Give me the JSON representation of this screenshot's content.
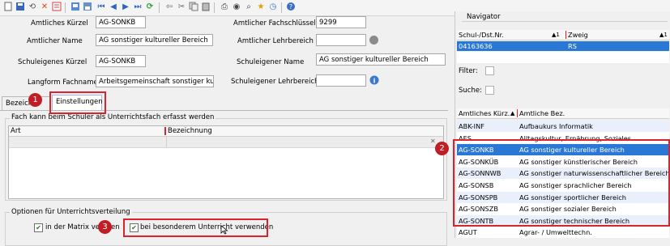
{
  "toolbar": {
    "icons": [
      "new-icon",
      "save-icon",
      "undo-icon",
      "delete-icon",
      "copy-icon",
      "grid-icon",
      "save-as-icon",
      "first-icon",
      "prev-icon",
      "next-icon",
      "last-icon",
      "refresh-icon",
      "back-icon",
      "cut-icon",
      "copy2-icon",
      "paste-icon",
      "print-icon",
      "preview-icon",
      "search-icon",
      "wizard-icon",
      "clock-icon",
      "help-icon"
    ]
  },
  "form": {
    "amtliches_kuerzel_label": "Amtliches  Kürzel",
    "amtliches_kuerzel_value": "AG-SONKB",
    "amtlicher_name_label": "Amtlicher Name",
    "amtlicher_name_value": "AG sonstiger kultureller Bereich",
    "schuleigenes_kuerzel_label": "Schuleigenes Kürzel",
    "schuleigenes_kuerzel_value": "AG-SONKB",
    "langform_label": "Langform Fachname",
    "langform_value": "Arbeitsgemeinschaft sonstiger kultu",
    "amtlicher_fachschluessel_label": "Amtlicher Fachschlüssel",
    "amtlicher_fachschluessel_value": "9299",
    "amtlicher_lehrbereich_label": "Amtlicher Lehrbereich",
    "amtlicher_lehrbereich_value": "",
    "schuleigener_name_label": "Schuleigener Name",
    "schuleigener_name_value": "AG sonstiger kultureller Bereich",
    "schuleigener_lehrbereich_label": "Schuleigener Lehrbereich",
    "schuleigener_lehrbereich_value": ""
  },
  "tabs": [
    {
      "label": "Bezeich"
    },
    {
      "label": "Einstellungen"
    }
  ],
  "section1": {
    "title": "Fach kann beim Schüler als Unterrichtsfach erfasst werden",
    "col_art": "Art",
    "col_bezeichnung": "Bezeichnung"
  },
  "section2": {
    "title": "Optionen für Unterrichtsverteilung",
    "check1_label": "in der Matrix ve",
    "check1_label_tail": "en",
    "check2_label": "bei besonderem Unterricht verwenden"
  },
  "badges": [
    "1",
    "2",
    "3"
  ],
  "navigator": {
    "title": "Navigator",
    "col1": "Schul-/Dst.Nr.",
    "col1_sort": "▲1",
    "col2": "Zweig",
    "col2_sort": "▲1",
    "row_nr": "04163636",
    "row_zweig": "RS",
    "filter_label": "Filter:",
    "suche_label": "Suche:",
    "list_col1": "Amtliches Kürz...",
    "list_col1_sort": "▲",
    "list_col2": "Amtliche Bez.",
    "rows": [
      {
        "code": "ABK-INF",
        "name": "Aufbaukurs Informatik"
      },
      {
        "code": "AES",
        "name": "Alltagskultur, Ernährung, Soziales"
      },
      {
        "code": "AG-SONKB",
        "name": "AG sonstiger kultureller Bereich"
      },
      {
        "code": "AG-SONKÜB",
        "name": "AG sonstiger künstlerischer Bereich"
      },
      {
        "code": "AG-SONNWB",
        "name": "AG sonstiger naturwissenschaftlicher Bereich"
      },
      {
        "code": "AG-SONSB",
        "name": "AG sonstiger sprachlicher Bereich"
      },
      {
        "code": "AG-SONSPB",
        "name": "AG sonstiger sportlicher Bereich"
      },
      {
        "code": "AG-SONSZB",
        "name": "AG sonstiger sozialer Bereich"
      },
      {
        "code": "AG-SONTB",
        "name": "AG sonstiger technischer Bereich"
      },
      {
        "code": "AGUT",
        "name": "Agrar- / Umwelttechn."
      }
    ]
  },
  "colors": {
    "highlight": "#2a78d6",
    "annotation_red": "#d9232e",
    "badge": "#c01d24"
  }
}
